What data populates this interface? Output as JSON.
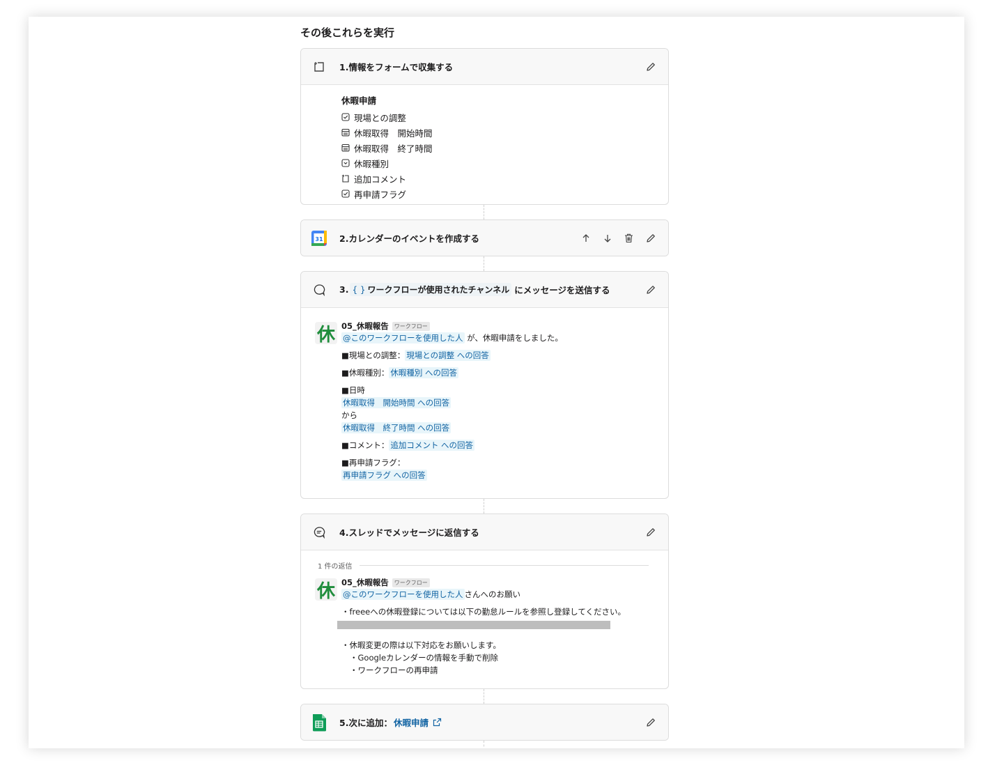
{
  "section_title": "その後これらを実行",
  "step1": {
    "title": "1.情報をフォームで収集する",
    "form_title": "休暇申請",
    "fields": [
      {
        "icon": "checkbox-icon",
        "label": "現場との調整"
      },
      {
        "icon": "calendar-icon",
        "label": "休暇取得　開始時間"
      },
      {
        "icon": "calendar-icon",
        "label": "休暇取得　終了時間"
      },
      {
        "icon": "dropdown-icon",
        "label": "休暇種別"
      },
      {
        "icon": "text-icon",
        "label": "追加コメント"
      },
      {
        "icon": "checkbox-icon",
        "label": "再申請フラグ"
      }
    ]
  },
  "step2": {
    "title": "2.カレンダーのイベントを作成する",
    "calendar_day": "31"
  },
  "step3": {
    "title_prefix": "3.",
    "title_chip_icon": "{ }",
    "title_chip": "ワークフローが使用されたチャンネル",
    "title_suffix": "にメッセージを送信する",
    "avatar_char": "休",
    "sender": "05_休暇報告",
    "badge": "ワークフロー",
    "mention": "@このワークフローを使用した人",
    "mention_suffix": "が、休暇申請をしました。",
    "r1_label": "■現場との調整：",
    "r1_chip": "現場との調整 への回答",
    "r2_label": "■休暇種別：",
    "r2_chip": "休暇種別 への回答",
    "r3_label": "■日時",
    "r3_chip_a": "休暇取得　開始時間 への回答",
    "r3_mid": "から",
    "r3_chip_b": "休暇取得　終了時間 への回答",
    "r4_label": "■コメント：",
    "r4_chip": "追加コメント への回答",
    "r5_label": "■再申請フラグ：",
    "r5_chip": "再申請フラグ への回答"
  },
  "step4": {
    "title": "4.スレッドでメッセージに返信する",
    "thread_label": "1 件の返信",
    "avatar_char": "休",
    "sender": "05_休暇報告",
    "badge": "ワークフロー",
    "mention": "@このワークフローを使用した人",
    "mention_suffix": "さんへのお願い",
    "line1": "・freeeへの休暇登録については以下の勤怠ルールを参照し登録してください。",
    "line2": "・休暇変更の際は以下対応をお願いします。",
    "line3": "・Googleカレンダーの情報を手動で削除",
    "line4": "・ワークフローの再申請"
  },
  "step5": {
    "title": "5.次に追加：",
    "link": "休暇申請"
  },
  "colors": {
    "link": "#1264a3",
    "chip_bg": "#e8f5fa",
    "avatar_green": "#1f8d3c",
    "sheets_green": "#0f9d58"
  }
}
